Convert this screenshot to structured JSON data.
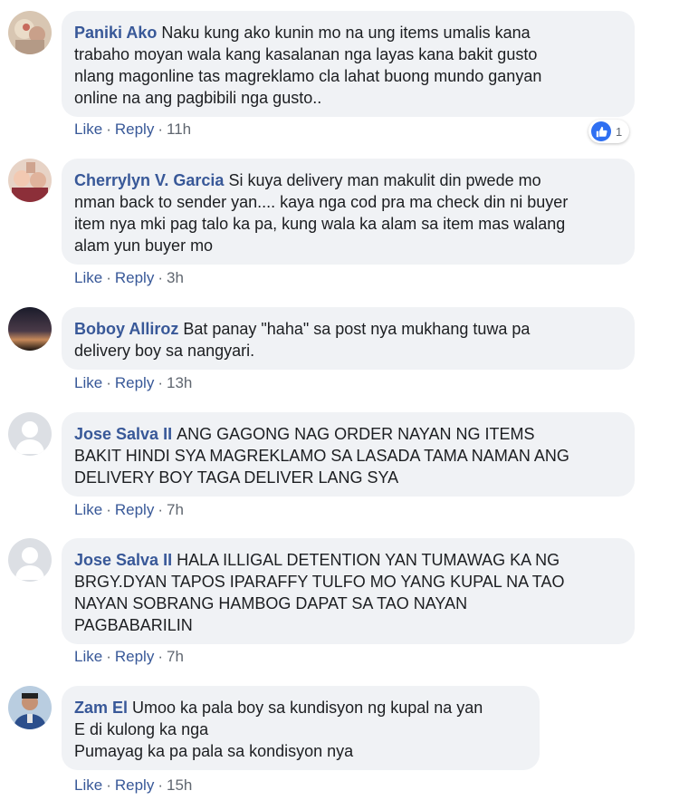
{
  "labels": {
    "like": "Like",
    "reply": "Reply",
    "separator": "·"
  },
  "comments": [
    {
      "author": "Paniki Ako",
      "text": "Naku kung ako kunin mo na ung items umalis kana\ntrabaho moyan wala kang kasalanan nga layas kana bakit gusto\nnlang magonline tas magreklamo cla lahat buong mundo ganyan\nonline na ang pagbibili nga gusto..",
      "time": "11h",
      "reaction": {
        "icon": "like-icon",
        "count": "1"
      }
    },
    {
      "author": "Cherrylyn V. Garcia",
      "text": "Si kuya delivery man makulit din pwede mo\nnman back to sender yan.... kaya nga cod pra ma check din ni buyer\nitem nya mki pag talo ka pa, kung wala ka alam sa item mas walang\nalam yun buyer mo",
      "time": "3h"
    },
    {
      "author": "Boboy Alliroz",
      "text": "Bat panay \"haha\" sa post nya mukhang tuwa pa\ndelivery boy sa nangyari.",
      "time": "13h"
    },
    {
      "author": "Jose Salva II",
      "text": "ANG GAGONG NAG ORDER NAYAN NG ITEMS\nBAKIT HINDI SYA MAGREKLAMO SA LASADA TAMA NAMAN ANG\nDELIVERY BOY TAGA DELIVER LANG SYA",
      "time": "7h"
    },
    {
      "author": "Jose Salva II",
      "text": "HALA ILLIGAL DETENTION YAN TUMAWAG KA NG\nBRGY.DYAN TAPOS IPARAFFY TULFO MO YANG KUPAL NA TAO\nNAYAN SOBRANG HAMBOG DAPAT SA TAO NAYAN\nPAGBABARILIN",
      "time": "7h"
    },
    {
      "author": "Zam El",
      "text": "Umoo ka pala boy sa kundisyon ng kupal na yan\nE di kulong ka nga\nPumayag ka pa pala sa kondisyon nya",
      "time": "15h"
    }
  ],
  "colors": {
    "author": "#385898",
    "bubble": "#f0f2f5",
    "meta": "#606770",
    "like_badge": "#2e6ff2"
  }
}
